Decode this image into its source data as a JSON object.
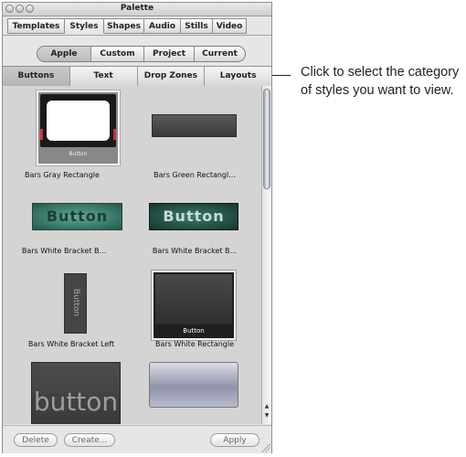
{
  "window": {
    "title": "Palette"
  },
  "main_tabs": [
    {
      "label": "Templates",
      "active": false
    },
    {
      "label": "Styles",
      "active": true
    },
    {
      "label": "Shapes",
      "active": false
    },
    {
      "label": "Audio",
      "active": false
    },
    {
      "label": "Stills",
      "active": false
    },
    {
      "label": "Video",
      "active": false
    }
  ],
  "source_tabs": [
    {
      "label": "Apple",
      "active": true
    },
    {
      "label": "Custom",
      "active": false
    },
    {
      "label": "Project",
      "active": false
    },
    {
      "label": "Current",
      "active": false
    }
  ],
  "category_tabs": [
    {
      "label": "Buttons",
      "active": true
    },
    {
      "label": "Text",
      "active": false
    },
    {
      "label": "Drop Zones",
      "active": false
    },
    {
      "label": "Layouts",
      "active": false
    }
  ],
  "items": [
    {
      "caption": "Bars Gray Rectangle",
      "thumb_text": "Button",
      "selected": true
    },
    {
      "caption": "Bars Green Rectangl...",
      "thumb_text": "",
      "selected": false
    },
    {
      "caption": "Bars White Bracket B...",
      "thumb_text": "Button",
      "selected": false
    },
    {
      "caption": "Bars White Bracket B...",
      "thumb_text": "Button",
      "selected": false
    },
    {
      "caption": "Bars White Bracket Left",
      "thumb_text": "Button",
      "selected": false
    },
    {
      "caption": "Bars White Rectangle",
      "thumb_text": "Button",
      "selected": true
    },
    {
      "caption": "",
      "thumb_text": "button",
      "selected": false
    },
    {
      "caption": "",
      "thumb_text": "",
      "selected": false
    }
  ],
  "buttons": {
    "delete": "Delete",
    "create": "Create...",
    "apply": "Apply"
  },
  "callout": {
    "text": "Click to select the category of styles you want to view."
  },
  "colors": {
    "panel": "#e6e6e6",
    "browser_bg": "#d4d4d4",
    "teal_button": "#2f6f62"
  }
}
